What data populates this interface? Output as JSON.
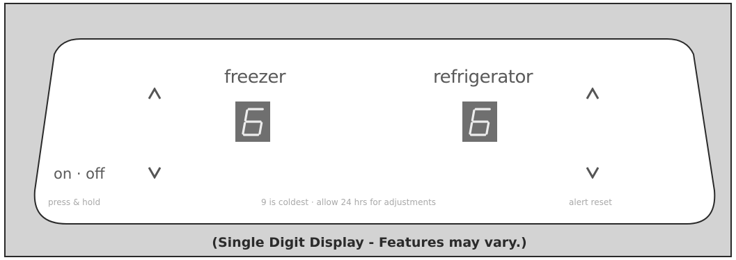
{
  "panel": {
    "freezer_label": "freezer",
    "refrigerator_label": "refrigerator",
    "freezer_digit": "6",
    "refrigerator_digit": "6",
    "power_label": "on · off",
    "power_hint": "press & hold",
    "info_text": "9 is coldest · allow 24 hrs for adjustments",
    "alert_reset_label": "alert reset"
  },
  "caption": "(Single Digit Display - Features may vary.)",
  "colors": {
    "frame_bg": "#d3d3d3",
    "panel_bg": "#ffffff",
    "digit_bg": "#6f6f6f",
    "segment_on": "#ededed",
    "text": "#5a5a5a"
  },
  "icons": {
    "up": "chevron-up-icon",
    "down": "chevron-down-icon"
  }
}
